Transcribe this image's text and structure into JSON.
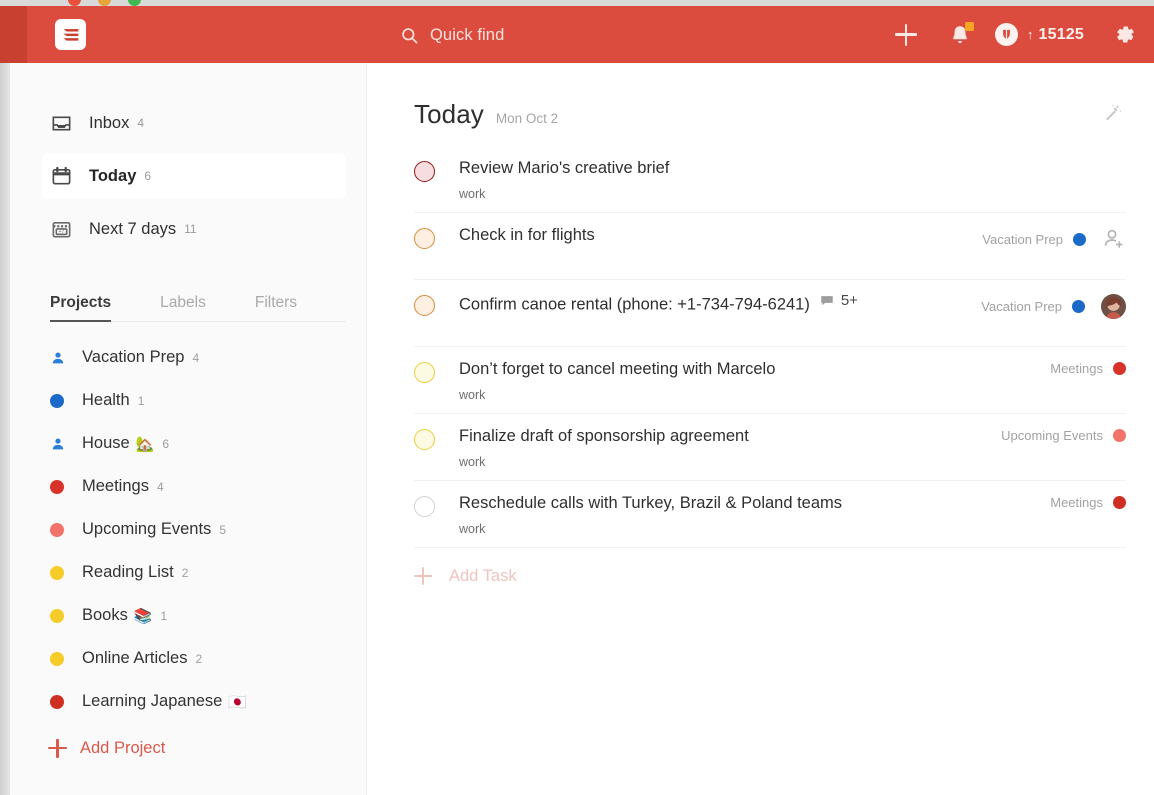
{
  "window": {
    "traffic_lights": [
      "close",
      "minimize",
      "zoom"
    ]
  },
  "header": {
    "logo_name": "todoist-logo",
    "search": {
      "placeholder": "Quick find",
      "icon": "search-icon"
    },
    "add_icon": "plus-icon",
    "notifications_icon": "bell-icon",
    "notifications_badge": true,
    "karma": {
      "icon": "karma-icon",
      "arrow": "↑",
      "points": "15125"
    },
    "settings_icon": "gear-icon"
  },
  "sidebar": {
    "nav": [
      {
        "label": "Inbox",
        "count": "4",
        "icon": "inbox-icon",
        "active": false
      },
      {
        "label": "Today",
        "count": "6",
        "icon": "calendar-icon",
        "active": true
      },
      {
        "label": "Next 7 days",
        "count": "11",
        "icon": "calendar-7-icon",
        "active": false
      }
    ],
    "tabs": [
      {
        "label": "Projects",
        "active": true
      },
      {
        "label": "Labels",
        "active": false
      },
      {
        "label": "Filters",
        "active": false
      }
    ],
    "projects": [
      {
        "label": "Vacation Prep",
        "count": "4",
        "color": "#2b7fd4",
        "shared": true,
        "emoji": ""
      },
      {
        "label": "Health",
        "count": "1",
        "color": "#1b6ac9",
        "shared": false,
        "emoji": ""
      },
      {
        "label": "House",
        "count": "6",
        "color": "#2b7fd4",
        "shared": true,
        "emoji": "🏡"
      },
      {
        "label": "Meetings",
        "count": "4",
        "color": "#d8332a",
        "shared": false,
        "emoji": ""
      },
      {
        "label": "Upcoming Events",
        "count": "5",
        "color": "#f2736a",
        "shared": false,
        "emoji": ""
      },
      {
        "label": "Reading List",
        "count": "2",
        "color": "#f5cc29",
        "shared": false,
        "emoji": ""
      },
      {
        "label": "Books",
        "count": "1",
        "color": "#f5cc29",
        "shared": false,
        "emoji": "📚"
      },
      {
        "label": "Online Articles",
        "count": "2",
        "color": "#f5cc29",
        "shared": false,
        "emoji": ""
      },
      {
        "label": "Learning Japanese",
        "count": "",
        "color": "#cf2e22",
        "shared": false,
        "emoji": "🇯🇵"
      }
    ],
    "add_project_label": "Add Project"
  },
  "main": {
    "title": "Today",
    "date": "Mon Oct 2",
    "wand_icon": "magic-wand-icon",
    "add_task_label": "Add Task",
    "tasks": [
      {
        "title": "Review Mario's creative brief",
        "label": "work",
        "priority": "p1",
        "project": "",
        "project_color": "",
        "comments": "",
        "assignee": "none"
      },
      {
        "title": "Check in for flights",
        "label": "",
        "priority": "p2",
        "project": "Vacation Prep",
        "project_color": "#1b6ac9",
        "comments": "",
        "assignee": "add-person"
      },
      {
        "title": "Confirm canoe rental (phone: +1-734-794-6241)",
        "label": "",
        "priority": "p2",
        "project": "Vacation Prep",
        "project_color": "#1b6ac9",
        "comments": "5+",
        "assignee": "photo"
      },
      {
        "title": "Don’t forget to cancel meeting with Marcelo",
        "label": "work",
        "priority": "p3",
        "project": "Meetings",
        "project_color": "#d8332a",
        "comments": "",
        "assignee": "none"
      },
      {
        "title": "Finalize draft of sponsorship agreement",
        "label": "work",
        "priority": "p3",
        "project": "Upcoming Events",
        "project_color": "#f2736a",
        "comments": "",
        "assignee": "none"
      },
      {
        "title": "Reschedule calls with Turkey, Brazil & Poland teams",
        "label": "work",
        "priority": "p4",
        "project": "Meetings",
        "project_color": "#cf2e22",
        "comments": "",
        "assignee": "none"
      }
    ]
  },
  "colors": {
    "brand_red": "#db4c3f",
    "sidebar_bg": "#fafafa",
    "accent_link": "#d9594c"
  }
}
